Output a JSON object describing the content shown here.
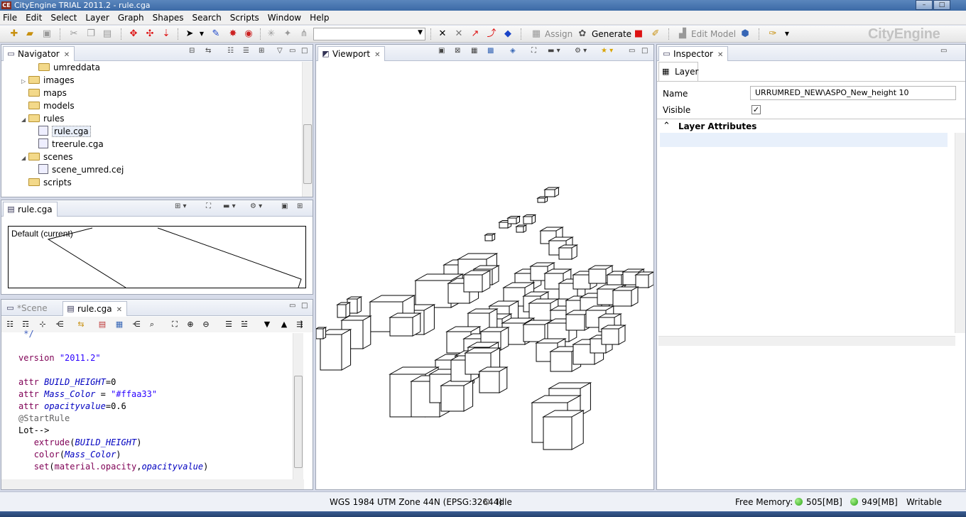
{
  "window": {
    "title": "CityEngine TRIAL 2011.2 - rule.cga",
    "app_icon": "CE"
  },
  "menu": [
    "File",
    "Edit",
    "Select",
    "Layer",
    "Graph",
    "Shapes",
    "Search",
    "Scripts",
    "Window",
    "Help"
  ],
  "toolbar": {
    "assign_label": "Assign",
    "generate_label": "Generate",
    "edit_model_label": "Edit Model",
    "brand": "CityEngine",
    "combo_value": ""
  },
  "navigator": {
    "tab_label": "Navigator",
    "items": [
      {
        "label": "umreddata",
        "type": "folder",
        "indent": 2,
        "toggle": ""
      },
      {
        "label": "images",
        "type": "folder",
        "indent": 1,
        "toggle": "▷"
      },
      {
        "label": "maps",
        "type": "folder",
        "indent": 1,
        "toggle": ""
      },
      {
        "label": "models",
        "type": "folder",
        "indent": 1,
        "toggle": ""
      },
      {
        "label": "rules",
        "type": "folder",
        "indent": 1,
        "toggle": "◢"
      },
      {
        "label": "rule.cga",
        "type": "file",
        "indent": 2,
        "toggle": "",
        "selected": true
      },
      {
        "label": "treerule.cga",
        "type": "file",
        "indent": 2,
        "toggle": ""
      },
      {
        "label": "scenes",
        "type": "folder",
        "indent": 1,
        "toggle": "◢"
      },
      {
        "label": "scene_umred.cej",
        "type": "file",
        "indent": 2,
        "toggle": ""
      },
      {
        "label": "scripts",
        "type": "folder",
        "indent": 1,
        "toggle": ""
      }
    ]
  },
  "rule_preview": {
    "tab_label": "rule.cga",
    "style_label": "Default (current)"
  },
  "editor": {
    "tabs": [
      {
        "label": "*Scene"
      },
      {
        "label": "rule.cga"
      }
    ],
    "code": {
      "comment_end": " */",
      "version_kw": "version",
      "version_str": "\"2011.2\"",
      "l1_kw": "attr",
      "l1_name": "BUILD_HEIGHT",
      "l1_val": "=0",
      "l2_kw": "attr",
      "l2_name": "Mass_Color",
      "l2_eq": " = ",
      "l2_val": "\"#ffaa33\"",
      "l3_kw": "attr",
      "l3_name": "opacityvalue",
      "l3_val": "=0.6",
      "annotation": "@StartRule",
      "rule": "Lot-->",
      "c1_fn": "extrude",
      "c1_arg": "BUILD_HEIGHT",
      "c2_fn": "color",
      "c2_arg": "Mass_Color",
      "c3_fn": "set",
      "c3_a1": "material.opacity",
      "c3_a2": "opacityvalue"
    }
  },
  "viewport": {
    "tab_label": "Viewport"
  },
  "inspector": {
    "tab_label": "Inspector",
    "layer_tab": "Layer",
    "name_label": "Name",
    "name_value": "URRUMRED_NEW\\ASPO_New_height 10",
    "visible_label": "Visible",
    "visible_checked": true,
    "section_label": "Layer Attributes"
  },
  "status": {
    "crs": "WGS 1984 UTM Zone 44N (EPSG:32644)",
    "state": "Idle",
    "free_memory_label": "Free Memory:",
    "mem1": "505[MB]",
    "mem2": "949[MB]",
    "mode": "Writable"
  }
}
